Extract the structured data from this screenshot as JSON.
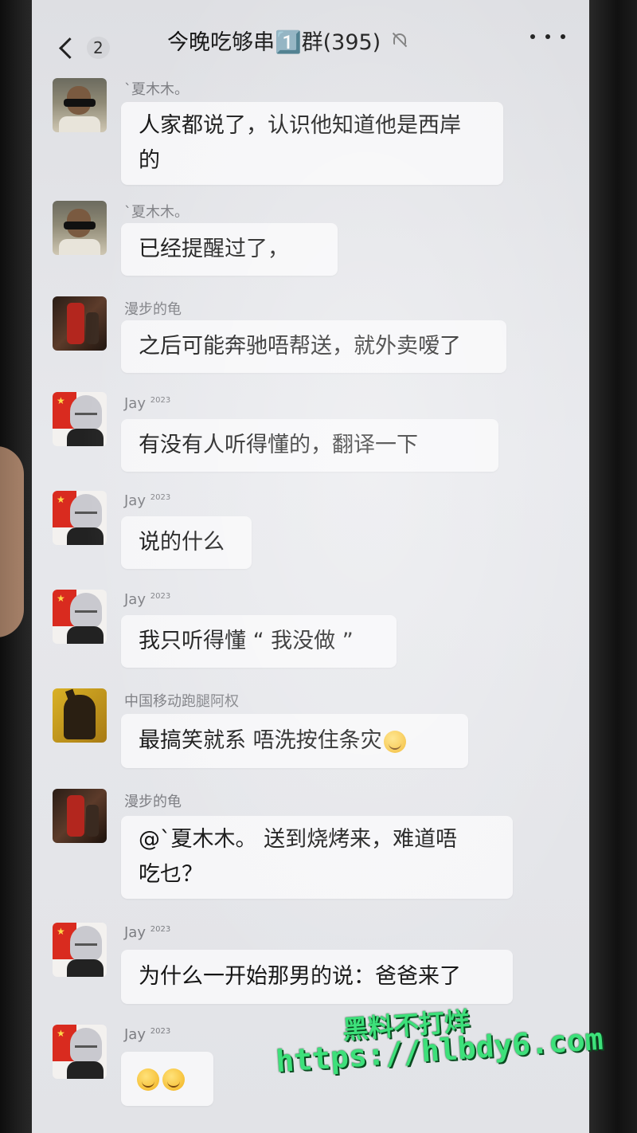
{
  "header": {
    "back_count": "2",
    "title": "今晚吃够串1️⃣群(395)"
  },
  "messages": [
    {
      "sender": "`夏木木。",
      "text_lines": [
        "人家都说了，认识他知道他是西岸",
        "的"
      ]
    },
    {
      "sender": "`夏木木。",
      "text": "已经提醒过了，"
    },
    {
      "sender": "漫步的龟",
      "text": "之后可能奔驰唔帮送，就外卖嗳了"
    },
    {
      "sender": "Jay",
      "sender_sup": "2023",
      "text": "有没有人听得懂的，翻译一下"
    },
    {
      "sender": "Jay",
      "sender_sup": "2023",
      "text": "说的什么"
    },
    {
      "sender": "Jay",
      "sender_sup": "2023",
      "text": "我只听得懂 “ 我没做 ”"
    },
    {
      "sender": "中国移动跑腿阿权",
      "text": "最搞笑就系  唔洗按住条灾"
    },
    {
      "sender": "漫步的龟",
      "text_lines": [
        "@`夏木木。 送到烧烤来，难道唔",
        "吃乜？"
      ]
    },
    {
      "sender": "Jay",
      "sender_sup": "2023",
      "text": "为什么一开始那男的说：爸爸来了"
    },
    {
      "sender": "Jay",
      "sender_sup": "2023",
      "text": ""
    }
  ],
  "icons": {
    "back": "chevron-left-icon",
    "mute": "bell-off-icon",
    "more": "more-horizontal-icon",
    "emoji": "hand-over-mouth-emoji"
  },
  "watermark": {
    "line1": "黑料不打烊",
    "line2": "https://hlbdy6.com"
  }
}
